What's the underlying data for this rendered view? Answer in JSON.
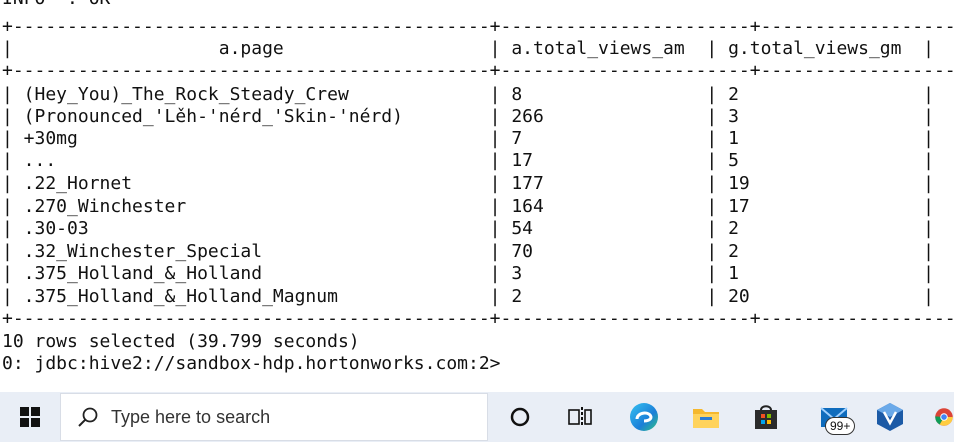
{
  "terminal": {
    "lines": [
      "INFO  : OK",
      "+--------------------------------------------+-----------------------+-----------------------+",
      "|                   a.page                   | a.total_views_am  | g.total_views_gm  |",
      "+--------------------------------------------+-----------------------+-----------------------+",
      "| (Hey_You)_The_Rock_Steady_Crew             | 8                 | 2                 |",
      "| (Pronounced_'Lěh-'nérd_'Skin-'nérd)        | 266               | 3                 |",
      "| +30mg                                      | 7                 | 1                 |",
      "| ...                                        | 17                | 5                 |",
      "| .22_Hornet                                 | 177               | 19                |",
      "| .270_Winchester                            | 164               | 17                |",
      "| .30-03                                     | 54                | 2                 |",
      "| .32_Winchester_Special                     | 70                | 2                 |",
      "| .375_Holland_&_Holland                     | 3                 | 1                 |",
      "| .375_Holland_&_Holland_Magnum              | 2                 | 20                |",
      "+--------------------------------------------+-----------------------+-----------------------+",
      "10 rows selected (39.799 seconds)",
      "0: jdbc:hive2://sandbox-hdp.hortonworks.com:2>"
    ]
  },
  "taskbar": {
    "search_placeholder": "Type here to search",
    "mail_badge": "99+",
    "icons": [
      "windows-start-icon",
      "search-icon",
      "cortana-circle-icon",
      "task-view-icon",
      "edge-icon",
      "file-explorer-icon",
      "store-icon",
      "mail-icon",
      "virtualbox-icon",
      "chrome-icon"
    ],
    "accent_color": "#e9eef6"
  }
}
